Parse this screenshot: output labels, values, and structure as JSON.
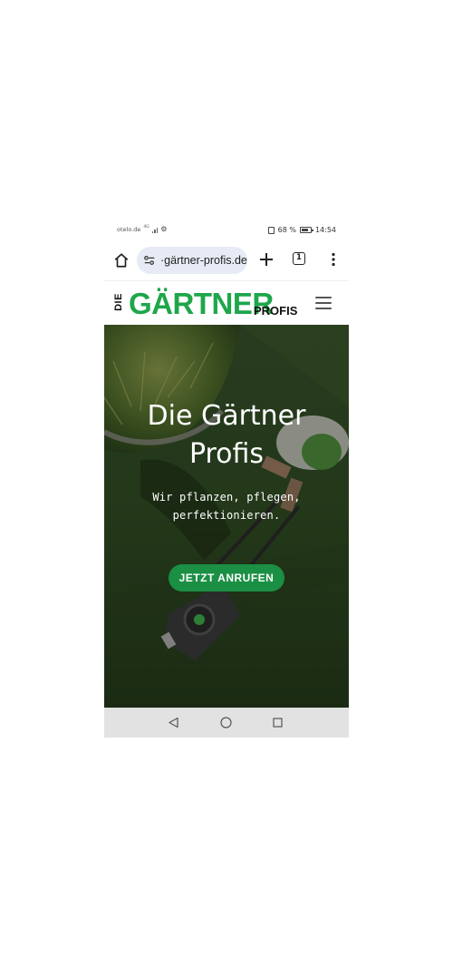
{
  "status_bar": {
    "carrier": "otelo.de",
    "network": "4G",
    "battery_percent": "68 %",
    "time": "14:54"
  },
  "browser": {
    "url": "·gärtner-profis.de",
    "tab_count": "1"
  },
  "site": {
    "logo": {
      "die": "DIE",
      "gaertner": "GÄRTNER",
      "profis": "PROFIS"
    },
    "hero": {
      "title_line1": "Die Gärtner",
      "title_line2": "Profis",
      "subtitle_line1": "Wir pflanzen, pflegen,",
      "subtitle_line2": "perfektionieren.",
      "cta_label": "JETZT ANRUFEN"
    }
  },
  "colors": {
    "brand_green": "#1ea64b",
    "cta_green": "#1b8f44"
  }
}
